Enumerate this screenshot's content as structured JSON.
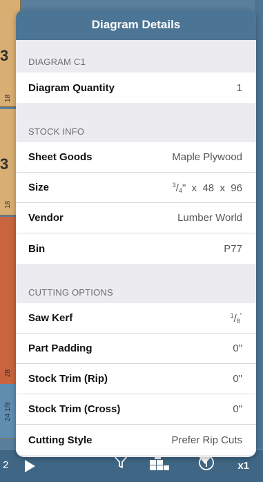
{
  "background": {
    "labels": [
      "3",
      "18",
      "3",
      "18",
      "28",
      "24 1/8"
    ]
  },
  "toolbar": {
    "count": "2",
    "zoom": "x1",
    "icons": [
      "play-icon",
      "filter-icon",
      "layout-blocks-icon",
      "info-icon"
    ]
  },
  "popover": {
    "title": "Diagram Details",
    "sections": {
      "diagram": {
        "header": "DIAGRAM C1",
        "quantity_label": "Diagram Quantity",
        "quantity_value": "1"
      },
      "stock": {
        "header": "STOCK INFO",
        "sheet_label": "Sheet Goods",
        "sheet_value": "Maple Plywood",
        "size_label": "Size",
        "size_thick_num": "3",
        "size_thick_den": "4",
        "size_rest": "\"  x  48  x  96",
        "vendor_label": "Vendor",
        "vendor_value": "Lumber World",
        "bin_label": "Bin",
        "bin_value": "P77"
      },
      "cutting": {
        "header": "CUTTING OPTIONS",
        "kerf_label": "Saw Kerf",
        "kerf_num": "1",
        "kerf_den": "8",
        "kerf_unit": "\"",
        "padding_label": "Part Padding",
        "padding_value": "0\"",
        "trim_rip_label": "Stock Trim (Rip)",
        "trim_rip_value": "0\"",
        "trim_cross_label": "Stock Trim (Cross)",
        "trim_cross_value": "0\"",
        "style_label": "Cutting Style",
        "style_value": "Prefer Rip Cuts"
      }
    }
  },
  "colors": {
    "header": "#4c7595",
    "toolbar": "#3f6684",
    "panel_bg": "#ebebf0",
    "section_text": "#6d6d72"
  }
}
